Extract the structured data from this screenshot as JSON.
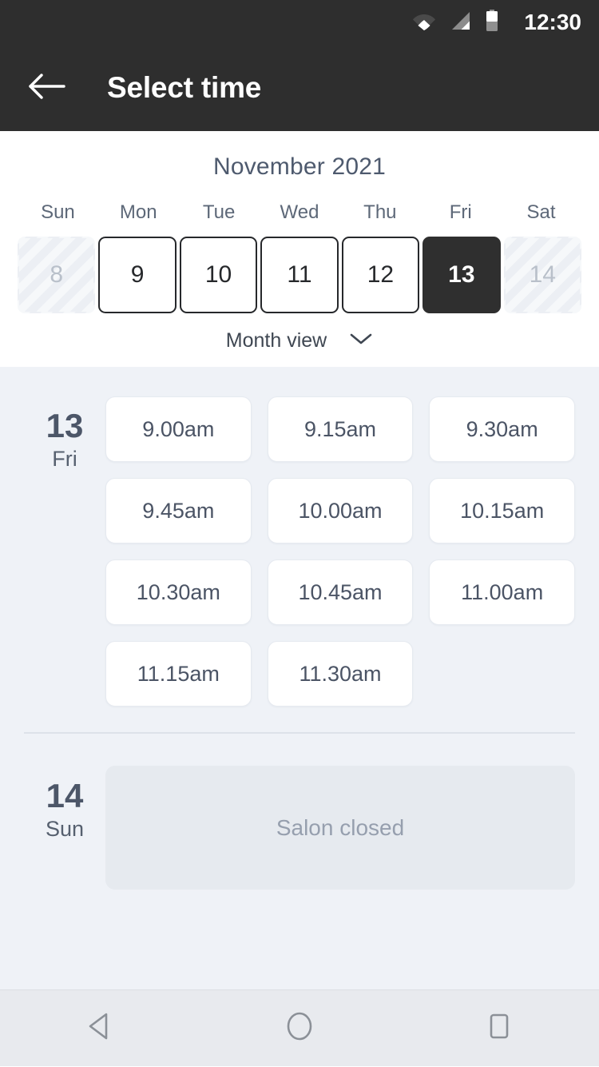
{
  "statusbar": {
    "time": "12:30",
    "icons": [
      "wifi-icon",
      "cellular-signal-icon",
      "battery-icon"
    ]
  },
  "appbar": {
    "title": "Select time",
    "back_icon": "arrow-left-icon"
  },
  "calendar": {
    "month_title": "November 2021",
    "weekdays": [
      "Sun",
      "Mon",
      "Tue",
      "Wed",
      "Thu",
      "Fri",
      "Sat"
    ],
    "days": [
      {
        "label": "8",
        "state": "disabled"
      },
      {
        "label": "9",
        "state": "enabled"
      },
      {
        "label": "10",
        "state": "enabled"
      },
      {
        "label": "11",
        "state": "enabled"
      },
      {
        "label": "12",
        "state": "enabled"
      },
      {
        "label": "13",
        "state": "selected"
      },
      {
        "label": "14",
        "state": "disabled"
      }
    ],
    "view_toggle": {
      "label": "Month view",
      "icon": "chevron-down-icon"
    }
  },
  "schedule": {
    "days": [
      {
        "date_number": "13",
        "day_of_week": "Fri",
        "slots": [
          "9.00am",
          "9.15am",
          "9.30am",
          "9.45am",
          "10.00am",
          "10.15am",
          "10.30am",
          "10.45am",
          "11.00am",
          "11.15am",
          "11.30am"
        ]
      },
      {
        "date_number": "14",
        "day_of_week": "Sun",
        "closed_message": "Salon closed"
      }
    ]
  },
  "navbar": {
    "back": "nav-back-icon",
    "home": "nav-home-icon",
    "recents": "nav-recents-icon"
  },
  "colors": {
    "appbar_bg": "#2e2e2e",
    "selected_day_bg": "#2f2f2f",
    "page_bg": "#eff2f7",
    "slot_bg": "#ffffff",
    "closed_card_bg": "#e6eaef",
    "text_slate": "#4c5668"
  }
}
